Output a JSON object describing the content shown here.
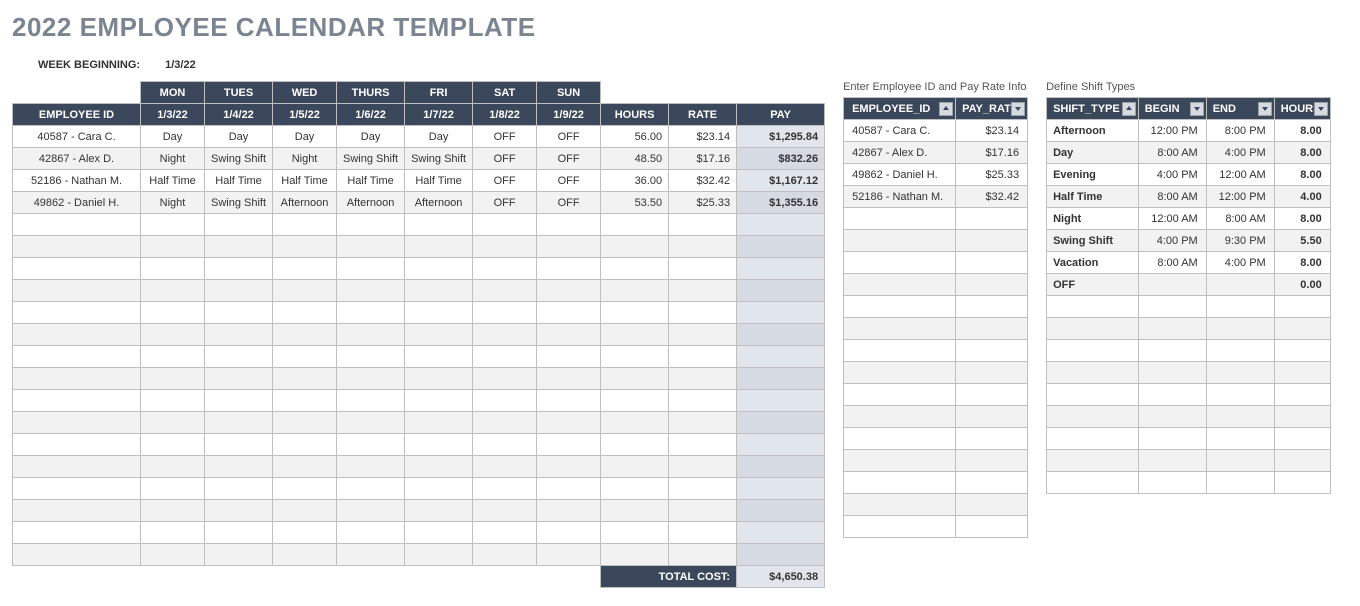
{
  "title": "2022 EMPLOYEE CALENDAR TEMPLATE",
  "week_label": "WEEK BEGINNING:",
  "week_value": "1/3/22",
  "main": {
    "headers_top": [
      "MON",
      "TUES",
      "WED",
      "THURS",
      "FRI",
      "SAT",
      "SUN"
    ],
    "headers": [
      "EMPLOYEE ID",
      "1/3/22",
      "1/4/22",
      "1/5/22",
      "1/6/22",
      "1/7/22",
      "1/8/22",
      "1/9/22",
      "HOURS",
      "RATE",
      "PAY"
    ],
    "rows": [
      {
        "emp": "40587 - Cara C.",
        "d": [
          "Day",
          "Day",
          "Day",
          "Day",
          "Day",
          "OFF",
          "OFF"
        ],
        "hours": "56.00",
        "rate": "$23.14",
        "pay": "$1,295.84"
      },
      {
        "emp": "42867 - Alex D.",
        "d": [
          "Night",
          "Swing Shift",
          "Night",
          "Swing Shift",
          "Swing Shift",
          "OFF",
          "OFF"
        ],
        "hours": "48.50",
        "rate": "$17.16",
        "pay": "$832.26"
      },
      {
        "emp": "52186 - Nathan M.",
        "d": [
          "Half Time",
          "Half Time",
          "Half Time",
          "Half Time",
          "Half Time",
          "OFF",
          "OFF"
        ],
        "hours": "36.00",
        "rate": "$32.42",
        "pay": "$1,167.12"
      },
      {
        "emp": "49862 - Daniel H.",
        "d": [
          "Night",
          "Swing Shift",
          "Afternoon",
          "Afternoon",
          "Afternoon",
          "OFF",
          "OFF"
        ],
        "hours": "53.50",
        "rate": "$25.33",
        "pay": "$1,355.16"
      }
    ],
    "empty_rows": 16,
    "total_label": "TOTAL COST:",
    "total_value": "$4,650.38"
  },
  "payrate": {
    "caption": "Enter Employee ID and Pay Rate Info",
    "headers": [
      "EMPLOYEE_ID",
      "PAY_RATE"
    ],
    "rows": [
      {
        "emp": "40587 - Cara C.",
        "rate": "$23.14"
      },
      {
        "emp": "42867 - Alex D.",
        "rate": "$17.16"
      },
      {
        "emp": "49862 - Daniel H.",
        "rate": "$25.33"
      },
      {
        "emp": "52186 - Nathan M.",
        "rate": "$32.42"
      }
    ],
    "empty_rows": 15
  },
  "shifts": {
    "caption": "Define Shift Types",
    "headers": [
      "SHIFT_TYPE",
      "BEGIN",
      "END",
      "HOURS"
    ],
    "rows": [
      {
        "type": "Afternoon",
        "begin": "12:00 PM",
        "end": "8:00 PM",
        "hours": "8.00"
      },
      {
        "type": "Day",
        "begin": "8:00 AM",
        "end": "4:00 PM",
        "hours": "8.00"
      },
      {
        "type": "Evening",
        "begin": "4:00 PM",
        "end": "12:00 AM",
        "hours": "8.00"
      },
      {
        "type": "Half Time",
        "begin": "8:00 AM",
        "end": "12:00 PM",
        "hours": "4.00"
      },
      {
        "type": "Night",
        "begin": "12:00 AM",
        "end": "8:00 AM",
        "hours": "8.00"
      },
      {
        "type": "Swing Shift",
        "begin": "4:00 PM",
        "end": "9:30 PM",
        "hours": "5.50"
      },
      {
        "type": "Vacation",
        "begin": "8:00 AM",
        "end": "4:00 PM",
        "hours": "8.00"
      },
      {
        "type": "OFF",
        "begin": "",
        "end": "",
        "hours": "0.00"
      }
    ],
    "empty_rows": 9
  }
}
